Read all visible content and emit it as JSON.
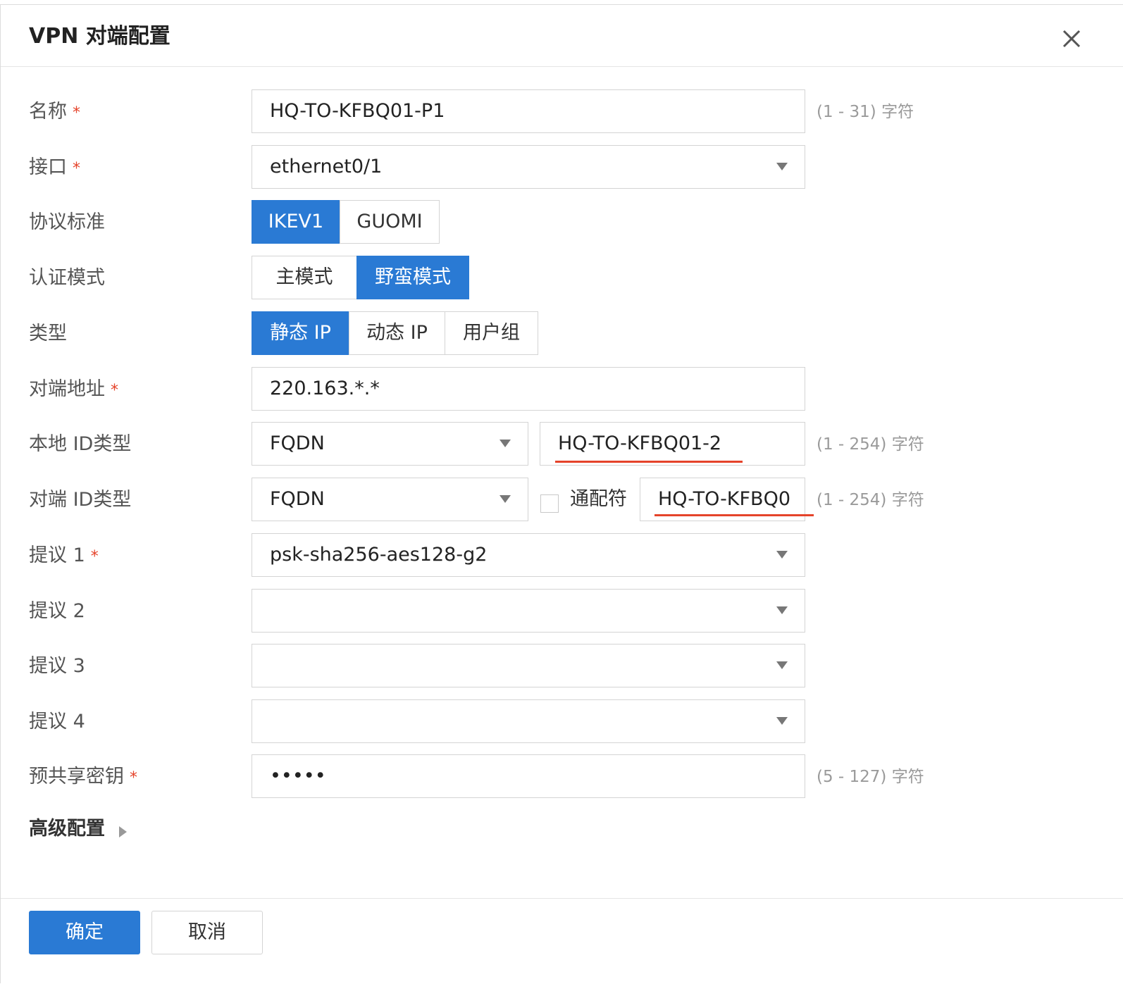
{
  "dialog": {
    "title": "VPN 对端配置"
  },
  "form": {
    "name": {
      "label": "名称",
      "required_mark": "*",
      "value": "HQ-TO-KFBQ01-P1",
      "hint": "(1 - 31) 字符"
    },
    "interface": {
      "label": "接口",
      "required_mark": "*",
      "value": "ethernet0/1"
    },
    "protocol": {
      "label": "协议标准",
      "options": [
        "IKEV1",
        "GUOMI"
      ],
      "selected": "IKEV1"
    },
    "auth_mode": {
      "label": "认证模式",
      "options": [
        "主模式",
        "野蛮模式"
      ],
      "selected": "野蛮模式"
    },
    "type": {
      "label": "类型",
      "options": [
        "静态 IP",
        "动态 IP",
        "用户组"
      ],
      "selected": "静态 IP"
    },
    "peer_address": {
      "label": "对端地址",
      "required_mark": "*",
      "value": "220.163.*.*"
    },
    "local_id": {
      "label": "本地 ID类型",
      "type_value": "FQDN",
      "value": "HQ-TO-KFBQ01-2",
      "hint": "(1 - 254) 字符"
    },
    "peer_id": {
      "label": "对端 ID类型",
      "type_value": "FQDN",
      "wildcard_label": "通配符",
      "wildcard_checked": false,
      "value": "HQ-TO-KFBQ0",
      "hint": "(1 - 254) 字符"
    },
    "proposal1": {
      "label": "提议 1",
      "required_mark": "*",
      "value": "psk-sha256-aes128-g2"
    },
    "proposal2": {
      "label": "提议 2",
      "value": ""
    },
    "proposal3": {
      "label": "提议 3",
      "value": ""
    },
    "proposal4": {
      "label": "提议 4",
      "value": ""
    },
    "psk": {
      "label": "预共享密钥",
      "required_mark": "*",
      "value": "•••••",
      "hint": "(5 - 127) 字符"
    },
    "advanced": {
      "label": "高级配置"
    }
  },
  "footer": {
    "confirm_label": "确定",
    "cancel_label": "取消"
  },
  "colors": {
    "accent": "#2a7ad4",
    "required": "#e5432a",
    "annotation_underline": "#e5432a"
  },
  "icons": {
    "close": "close-icon",
    "dropdown": "chevron-down-icon",
    "expand": "caret-right-icon"
  }
}
